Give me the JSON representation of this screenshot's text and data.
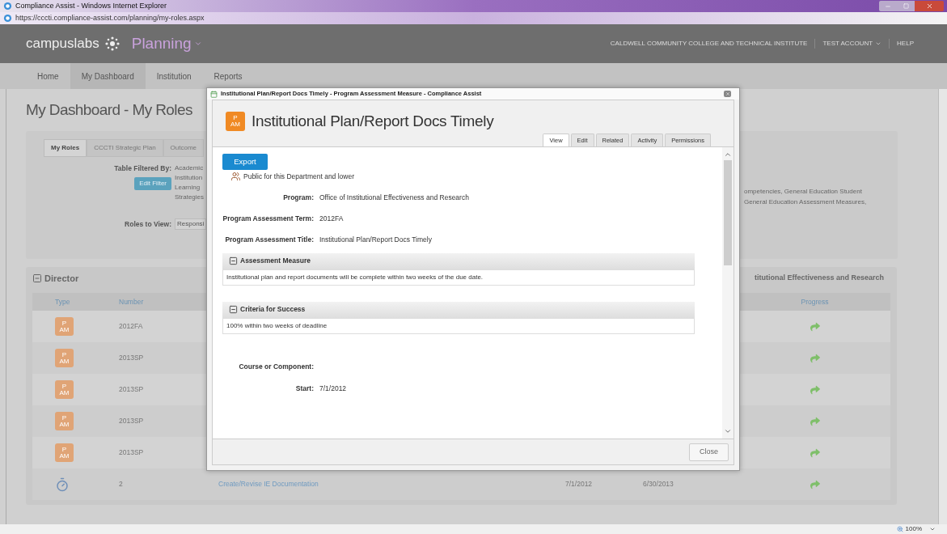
{
  "browser": {
    "title": "Compliance Assist - Windows Internet Explorer",
    "url": "https://cccti.compliance-assist.com/planning/my-roles.aspx",
    "zoom": "100%"
  },
  "app_header": {
    "brand": "campuslabs",
    "module": "Planning",
    "links": [
      {
        "label": "CALDWELL COMMUNITY COLLEGE AND TECHNICAL INSTITUTE",
        "dropdown": false
      },
      {
        "label": "TEST ACCOUNT",
        "dropdown": true
      },
      {
        "label": "HELP",
        "dropdown": false
      }
    ]
  },
  "nav": [
    {
      "label": "Home",
      "selected": false
    },
    {
      "label": "My Dashboard",
      "selected": true
    },
    {
      "label": "Institution",
      "selected": false
    },
    {
      "label": "Reports",
      "selected": false
    }
  ],
  "page": {
    "title": "My Dashboard - My Roles",
    "tabs": [
      {
        "label": "My Roles",
        "selected": true
      },
      {
        "label": "CCCTI Strategic Plan",
        "selected": false
      },
      {
        "label": "Outcome",
        "selected": false
      }
    ],
    "filter": {
      "label": "Table Filtered By:",
      "button": "Edit Filter",
      "values_left": [
        "Academic",
        "Institution",
        "Learning",
        "Strategies"
      ],
      "values_right": [
        "ompetencies, General Education Student",
        "General Education Assessment Measures,"
      ]
    },
    "roles": {
      "label": "Roles to View:",
      "value": "Responsi"
    }
  },
  "section": {
    "title": "Director",
    "expanded": true,
    "title_right": "titutional Effectiveness and Research",
    "columns": [
      {
        "label": "Type"
      },
      {
        "label": "Number"
      },
      {
        "label": "Progress"
      }
    ],
    "rows": [
      {
        "type": {
          "kind": "badge",
          "top": "P",
          "bottom": "AM"
        },
        "number": "2012FA"
      },
      {
        "type": {
          "kind": "badge",
          "top": "P",
          "bottom": "AM"
        },
        "number": "2013SP"
      },
      {
        "type": {
          "kind": "badge",
          "top": "P",
          "bottom": "AM"
        },
        "number": "2013SP"
      },
      {
        "type": {
          "kind": "badge",
          "top": "P",
          "bottom": "AM"
        },
        "number": "2013SP"
      },
      {
        "type": {
          "kind": "badge",
          "top": "P",
          "bottom": "AM"
        },
        "number": "2013SP"
      },
      {
        "type": {
          "kind": "stopwatch"
        },
        "number": "2",
        "title": "Create/Revise IE Documentation",
        "start": "7/1/2012",
        "end": "6/30/2013"
      }
    ]
  },
  "dialog": {
    "window_title": "Institutional Plan/Report Docs Timely - Program Assessment Measure - Compliance Assist",
    "badge": {
      "top": "P",
      "bottom": "AM"
    },
    "title": "Institutional Plan/Report Docs Timely",
    "tabs": [
      {
        "label": "View",
        "selected": true
      },
      {
        "label": "Edit",
        "selected": false
      },
      {
        "label": "Related",
        "selected": false
      },
      {
        "label": "Activity",
        "selected": false
      },
      {
        "label": "Permissions",
        "selected": false
      }
    ],
    "export": "Export",
    "visibility": "Public for this Department and lower",
    "fields": [
      {
        "label": "Program:",
        "value": "Office of Institutional Effectiveness and Research"
      },
      {
        "label": "Program Assessment Term:",
        "value": "2012FA"
      },
      {
        "label": "Program Assessment Title:",
        "value": "Institutional Plan/Report Docs Timely"
      }
    ],
    "sections": [
      {
        "title": "Assessment Measure",
        "expanded": true,
        "body": "Institutional plan and report documents will be complete within two weeks of the due date."
      },
      {
        "title": "Criteria for Success",
        "expanded": true,
        "body": "100% within two weeks of deadline"
      }
    ],
    "fields_after": [
      {
        "label": "Course or Component:"
      },
      {
        "label": "Start:",
        "value": "7/1/2012"
      }
    ],
    "close": "Close"
  }
}
